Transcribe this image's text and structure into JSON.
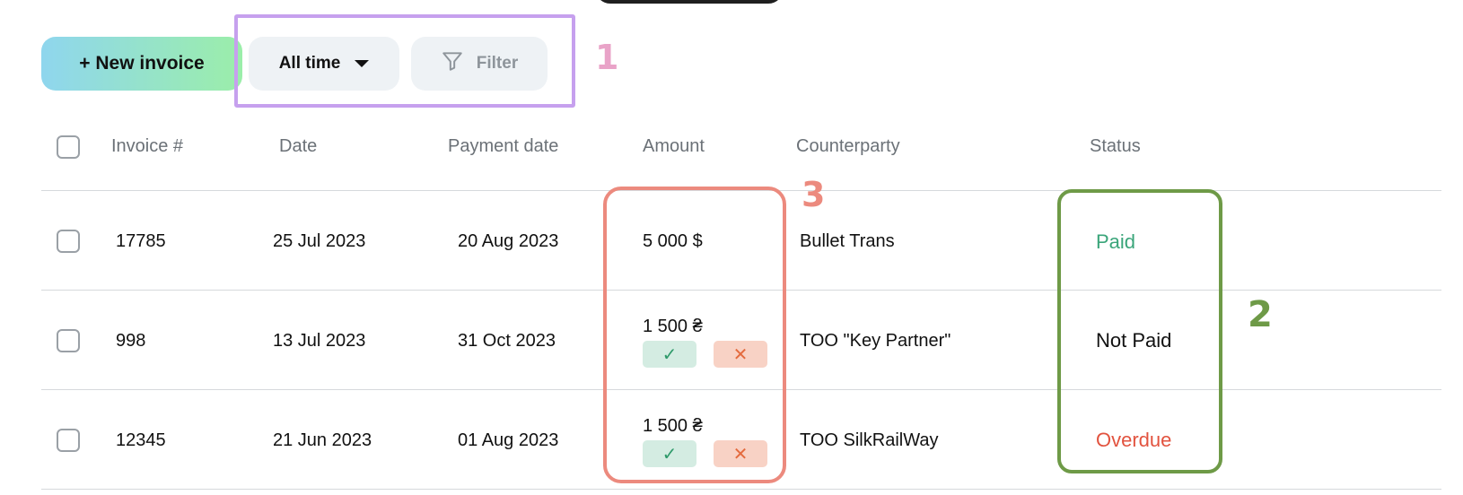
{
  "toolbar": {
    "new_invoice": "+ New invoice",
    "period": "All time",
    "filter": "Filter"
  },
  "callouts": {
    "one": "1",
    "two": "2",
    "three": "3"
  },
  "table": {
    "headers": {
      "invoice": "Invoice #",
      "date": "Date",
      "payment_date": "Payment date",
      "amount": "Amount",
      "counterparty": "Counterparty",
      "status": "Status"
    },
    "rows": [
      {
        "invoice": "17785",
        "date": "25 Jul 2023",
        "payment_date": "20 Aug 2023",
        "amount": "5 000  $",
        "counterparty": "Bullet Trans",
        "status": "Paid",
        "has_actions": false
      },
      {
        "invoice": "998",
        "date": "13 Jul 2023",
        "payment_date": "31 Oct 2023",
        "amount": "1 500 ₴",
        "counterparty": "TOO \"Key Partner\"",
        "status": "Not Paid",
        "has_actions": true
      },
      {
        "invoice": "12345",
        "date": "21 Jun 2023",
        "payment_date": "01 Aug 2023",
        "amount": "1 500 ₴",
        "counterparty": "TOO SilkRailWay",
        "status": "Overdue",
        "has_actions": true
      }
    ],
    "action_icons": {
      "approve": "✓",
      "reject": "✕"
    }
  },
  "colors": {
    "paid": "#3aa57a",
    "not_paid": "#111111",
    "overdue": "#e2533f"
  }
}
